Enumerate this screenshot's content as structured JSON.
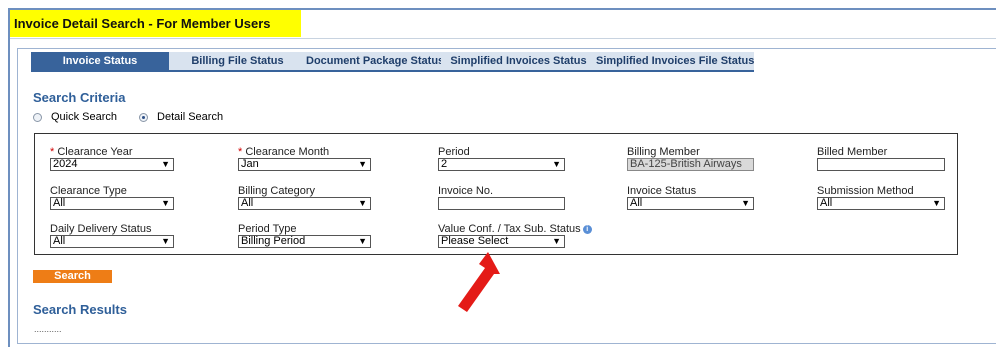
{
  "page": {
    "title": "Invoice Detail Search - For Member Users"
  },
  "tabs": [
    {
      "label": "Invoice Status",
      "active": true
    },
    {
      "label": "Billing File Status",
      "active": false
    },
    {
      "label": "Document Package Status",
      "active": false
    },
    {
      "label": "Simplified Invoices Status",
      "active": false
    },
    {
      "label": "Simplified Invoices File Status",
      "active": false
    }
  ],
  "criteria": {
    "heading": "Search Criteria",
    "mode_options": [
      {
        "label": "Quick Search",
        "selected": false
      },
      {
        "label": "Detail Search",
        "selected": true
      }
    ]
  },
  "fields": {
    "clearance_year": {
      "required_mark": "*",
      "label": "Clearance Year",
      "value": "2024"
    },
    "clearance_month": {
      "required_mark": "*",
      "label": "Clearance Month",
      "value": "Jan"
    },
    "period": {
      "label": "Period",
      "value": "2"
    },
    "billing_member": {
      "label": "Billing Member",
      "value": "BA-125-British Airways"
    },
    "billed_member": {
      "label": "Billed Member",
      "value": ""
    },
    "clearance_type": {
      "label": "Clearance Type",
      "value": "All"
    },
    "billing_category": {
      "label": "Billing Category",
      "value": "All"
    },
    "invoice_no": {
      "label": "Invoice No.",
      "value": ""
    },
    "invoice_status": {
      "label": "Invoice Status",
      "value": "All"
    },
    "submission_method": {
      "label": "Submission Method",
      "value": "All"
    },
    "daily_delivery_status": {
      "label": "Daily Delivery Status",
      "value": "All"
    },
    "period_type": {
      "label": "Period Type",
      "value": "Billing Period"
    },
    "value_conf_tax_sub_status": {
      "label": "Value Conf. / Tax Sub. Status",
      "value": "Please Select"
    }
  },
  "actions": {
    "search_label": "Search"
  },
  "results": {
    "heading": "Search Results",
    "placeholder": "..........."
  },
  "annotation": {
    "arrow_color": "#e41b17"
  },
  "colors": {
    "accent": "#38639b",
    "tab_inactive": "#d9e3ef",
    "button": "#ee7d16",
    "title_highlight": "#ffff00"
  }
}
